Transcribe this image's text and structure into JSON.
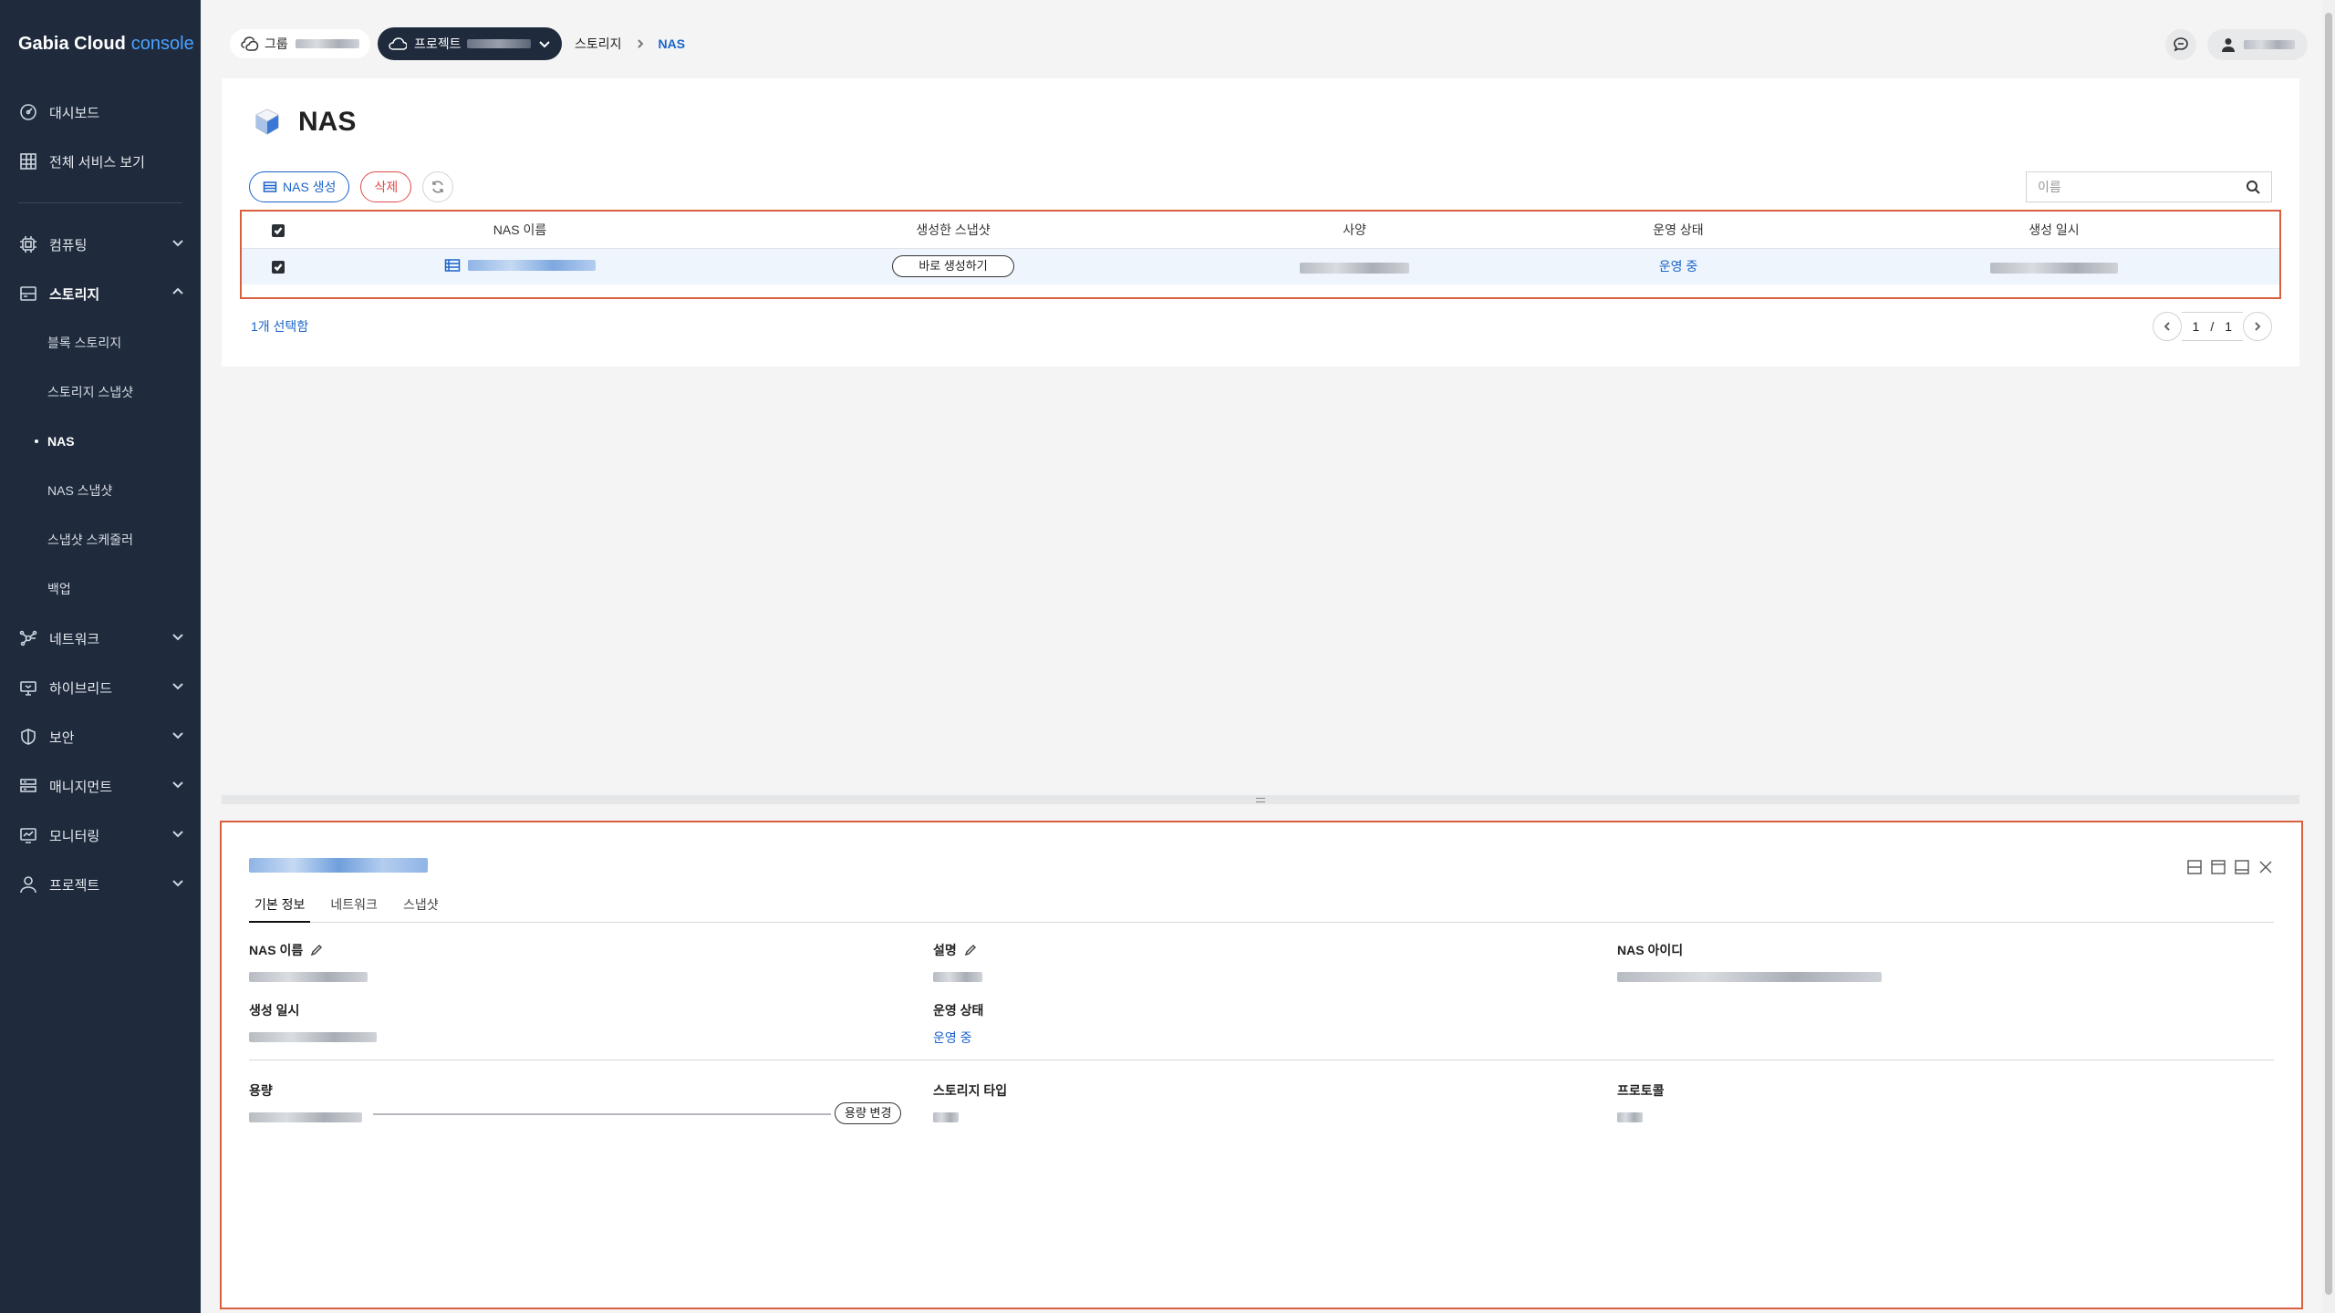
{
  "brand": {
    "name": "Gabia Cloud",
    "suffix": "console"
  },
  "sidebar": {
    "top": [
      {
        "label": "대시보드",
        "icon": "dashboard-icon"
      },
      {
        "label": "전체 서비스 보기",
        "icon": "grid-icon"
      }
    ],
    "groups": [
      {
        "label": "컴퓨팅",
        "icon": "cpu-icon",
        "expanded": false
      },
      {
        "label": "스토리지",
        "icon": "storage-icon",
        "expanded": true,
        "children": [
          {
            "label": "블록 스토리지",
            "active": false
          },
          {
            "label": "스토리지 스냅샷",
            "active": false
          },
          {
            "label": "NAS",
            "active": true
          },
          {
            "label": "NAS 스냅샷",
            "active": false
          },
          {
            "label": "스냅샷 스케줄러",
            "active": false
          },
          {
            "label": "백업",
            "active": false
          }
        ]
      },
      {
        "label": "네트워크",
        "icon": "network-icon",
        "expanded": false
      },
      {
        "label": "하이브리드",
        "icon": "hybrid-icon",
        "expanded": false
      },
      {
        "label": "보안",
        "icon": "shield-icon",
        "expanded": false
      },
      {
        "label": "매니지먼트",
        "icon": "management-icon",
        "expanded": false
      },
      {
        "label": "모니터링",
        "icon": "monitor-icon",
        "expanded": false
      },
      {
        "label": "프로젝트",
        "icon": "user-icon",
        "expanded": false
      }
    ]
  },
  "topbar": {
    "group_label": "그룹",
    "project_label": "프로젝트",
    "breadcrumb": [
      "스토리지",
      "NAS"
    ]
  },
  "page": {
    "title": "NAS",
    "create_button": "NAS 생성",
    "delete_button": "삭제",
    "search_placeholder": "이름",
    "table": {
      "headers": [
        "NAS 이름",
        "생성한 스냅샷",
        "사양",
        "운영 상태",
        "생성 일시"
      ],
      "rows": [
        {
          "snapshot_button": "바로 생성하기",
          "status": "운영 중"
        }
      ]
    },
    "selected_count": "1개 선택함",
    "pager": {
      "current": "1",
      "sep": "/",
      "total": "1"
    }
  },
  "detail": {
    "tabs": [
      "기본 정보",
      "네트워크",
      "스냅샷"
    ],
    "fields": {
      "nas_name": "NAS 이름",
      "description": "설명",
      "nas_id": "NAS 아이디",
      "created_at": "생성 일시",
      "status_label": "운영 상태",
      "status_value": "운영 중",
      "capacity": "용량",
      "capacity_button": "용량 변경",
      "storage_type": "스토리지 타입",
      "protocol": "프로토콜"
    }
  },
  "colors": {
    "sidebar_bg": "#1f2a3c",
    "accent": "#1c64c9",
    "danger": "#e04a4a",
    "highlight_border": "#d9603e"
  }
}
